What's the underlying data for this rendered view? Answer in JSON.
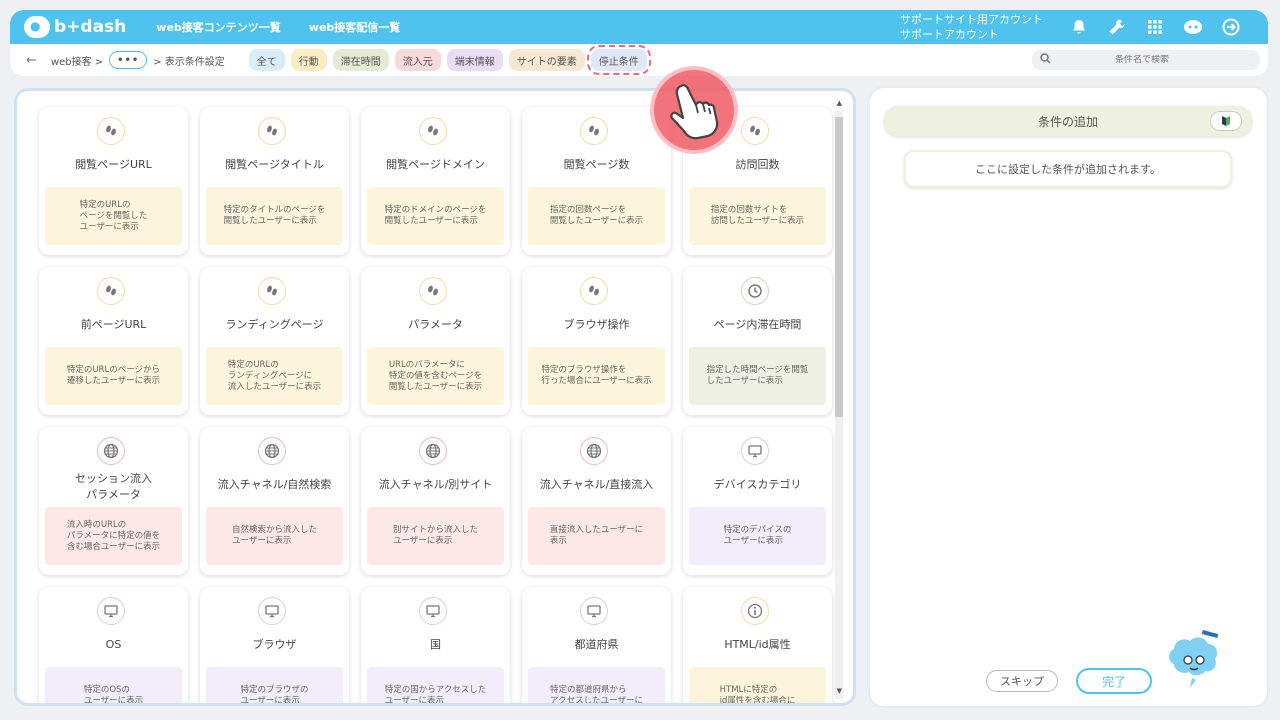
{
  "app": {
    "logo": "b+dash"
  },
  "topnav": [
    "web接客コンテンツ一覧",
    "web接客配信一覧"
  ],
  "account": {
    "line1": "サポートサイト用アカウント",
    "line2": "サポートアカウント"
  },
  "breadcrumb": {
    "item1": "web接客",
    "sep1": ">",
    "more": "•••",
    "sep2": ">",
    "current": "表示条件設定"
  },
  "tabs": [
    "全て",
    "行動",
    "滞在時間",
    "流入元",
    "端末情報",
    "サイトの要素",
    "停止条件"
  ],
  "search": {
    "placeholder": "条件名で検索"
  },
  "cards": [
    {
      "title": "閲覧ページURL",
      "desc": "特定のURLの\nページを閲覧した\nユーザーに表示"
    },
    {
      "title": "閲覧ページタイトル",
      "desc": "特定のタイトルのページを\n閲覧したユーザーに表示"
    },
    {
      "title": "閲覧ページドメイン",
      "desc": "特定のドメインのページを\n閲覧したユーザーに表示"
    },
    {
      "title": "閲覧ページ数",
      "desc": "指定の回数ページを\n閲覧したユーザーに表示"
    },
    {
      "title": "訪問回数",
      "desc": "指定の回数サイトを\n訪問したユーザーに表示"
    },
    {
      "title": "前ページURL",
      "desc": "特定のURLのページから\n遷移したユーザーに表示"
    },
    {
      "title": "ランディングページ",
      "desc": "特定のURLの\nランディングページに\n流入したユーザーに表示"
    },
    {
      "title": "パラメータ",
      "desc": "URLのパラメータに\n特定の値を含むページを\n閲覧したユーザーに表示"
    },
    {
      "title": "ブラウザ操作",
      "desc": "特定のブラウザ操作を\n行った場合にユーザーに表示"
    },
    {
      "title": "ページ内滞在時間",
      "desc": "指定した時間ページを閲覧\nしたユーザーに表示"
    },
    {
      "title": "セッション流入\nパラメータ",
      "desc": "流入時のURLの\nパラメータに特定の値を\n含む場合ユーザーに表示"
    },
    {
      "title": "流入チャネル/自然検索",
      "desc": "自然検索から流入した\nユーザーに表示"
    },
    {
      "title": "流入チャネル/別サイト",
      "desc": "別サイトから流入した\nユーザーに表示"
    },
    {
      "title": "流入チャネル/直接流入",
      "desc": "直接流入したユーザーに\n表示"
    },
    {
      "title": "デバイスカテゴリ",
      "desc": "特定のデバイスの\nユーザーに表示"
    },
    {
      "title": "OS",
      "desc": "特定のOSの\nユーザーに表示"
    },
    {
      "title": "ブラウザ",
      "desc": "特定のブラウザの\nユーザーに表示"
    },
    {
      "title": "国",
      "desc": "特定の国からアクセスした\nユーザーに表示"
    },
    {
      "title": "都道府県",
      "desc": "特定の都道府県から\nアクセスしたユーザーに"
    },
    {
      "title": "HTML/id属性",
      "desc": "HTMLに特定の\nid属性を含む場合に"
    }
  ],
  "right": {
    "header": "条件の追加",
    "placeholder": "ここに設定した条件が追加されます。",
    "skip": "スキップ",
    "done": "完了"
  },
  "colors": {
    "accent": "#4fc3ee",
    "pointer": "#f05a64"
  }
}
